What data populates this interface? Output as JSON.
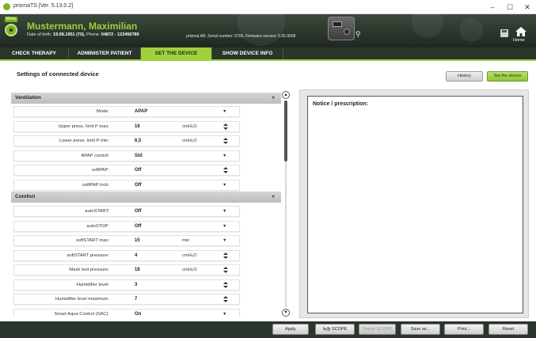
{
  "window": {
    "title": "prismaTS [Ver. 5.13.0.2]",
    "minimize": "–",
    "maximize": "☐",
    "close": "✕"
  },
  "header": {
    "menu_label": "Menu",
    "patient_name": "Mustermann, Maximilian",
    "dob_prefix": "Date of birth:",
    "dob": "19.08.1951 (70),",
    "phone_prefix": "Phone:",
    "phone": "04872 - 123456789",
    "device_info": "prismaLAB, Serial number: 6705, Firmware version: 5.05.9008",
    "home_label": "Home",
    "icons": [
      "patient-icon",
      "device-image",
      "usb-icon",
      "save-icon",
      "home-icon"
    ]
  },
  "tabs": [
    {
      "label": "CHECK THERAPY",
      "active": false
    },
    {
      "label": "ADMINISTER PATIENT",
      "active": false
    },
    {
      "label": "SET THE DEVICE",
      "active": true
    },
    {
      "label": "SHOW DEVICE INFO",
      "active": false
    }
  ],
  "page": {
    "title": "Settings of connected device",
    "history_button": "History",
    "set_device_button": "Set the device"
  },
  "ventilation": {
    "title": "Ventilation",
    "collapse_icon": "«",
    "rows": [
      {
        "label": "Mode:",
        "value": "APAP",
        "unit": "",
        "control": "dropdown"
      },
      {
        "label": "Upper press. limit P max:",
        "value": "16",
        "unit": "cmH₂O",
        "control": "spinner"
      },
      {
        "label": "Lower press. limit P min:",
        "value": "6,5",
        "unit": "cmH₂O",
        "control": "spinner"
      },
      {
        "label": "APAP control:",
        "value": "Std",
        "unit": "",
        "control": "dropdown"
      },
      {
        "label": "softPAP:",
        "value": "Off",
        "unit": "",
        "control": "spinner"
      },
      {
        "label": "softPAP lock:",
        "value": "Off",
        "unit": "",
        "control": "dropdown"
      }
    ]
  },
  "comfort": {
    "title": "Comfort",
    "collapse_icon": "«",
    "rows": [
      {
        "label": "autoSTART:",
        "value": "Off",
        "unit": "",
        "control": "dropdown"
      },
      {
        "label": "autoSTOP:",
        "value": "Off",
        "unit": "",
        "control": "dropdown"
      },
      {
        "label": "softSTART max:",
        "value": "15",
        "unit": "min",
        "control": "dropdown"
      },
      {
        "label": "softSTART pressure:",
        "value": "4",
        "unit": "cmH₂O",
        "control": "spinner"
      },
      {
        "label": "Mask test pressure:",
        "value": "18",
        "unit": "cmH₂O",
        "control": "spinner"
      },
      {
        "label": "Humidifier level:",
        "value": "3",
        "unit": "",
        "control": "spinner"
      },
      {
        "label": "Humidifier level maximum:",
        "value": "7",
        "unit": "",
        "control": "spinner"
      },
      {
        "label": "Smart Aqua Control (SAC):",
        "value": "On",
        "unit": "",
        "control": "dropdown"
      }
    ]
  },
  "notice": {
    "label": "Notice / prescription:"
  },
  "footer": {
    "apply": "Apply",
    "scope": "SCOPE",
    "delete_scope": "Delete SCOPE",
    "save_as": "Save as...",
    "print": "Print...",
    "reset": "Reset"
  },
  "colors": {
    "accent": "#9ed13c",
    "dark": "#2a352c"
  }
}
